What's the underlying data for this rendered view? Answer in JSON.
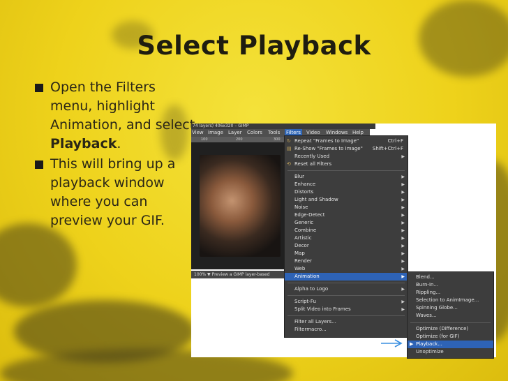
{
  "slide": {
    "title": "Select Playback",
    "bullets": [
      {
        "parts": [
          "Open the Filters menu, highlight Animation, and select ",
          "Playback",
          "."
        ]
      },
      {
        "parts": [
          "This will bring up a playback window where you can preview your GIF.",
          "",
          ""
        ]
      }
    ]
  },
  "gimp": {
    "window_title": "74 layers) 406x320 – GIMP",
    "menubar": [
      "View",
      "Image",
      "Layer",
      "Colors",
      "Tools",
      "Filters",
      "Video",
      "Windows",
      "Help"
    ],
    "active_menu": "Filters",
    "ruler_labels": [
      "100",
      "200",
      "300"
    ],
    "status": "100% ▼ Preview a GIMP layer-based"
  },
  "filters_menu": {
    "top_items": [
      {
        "label": "Repeat \"Frames to Image\"",
        "shortcut": "Ctrl+F",
        "icon": "repeat-icon"
      },
      {
        "label": "Re-Show \"Frames to Image\"",
        "shortcut": "Shift+Ctrl+F",
        "icon": "reshow-icon"
      },
      {
        "label": "Recently Used",
        "submenu": true
      },
      {
        "label": "Reset all Filters",
        "icon": "reset-icon"
      }
    ],
    "categories": [
      "Blur",
      "Enhance",
      "Distorts",
      "Light and Shadow",
      "Noise",
      "Edge-Detect",
      "Generic",
      "Combine",
      "Artistic",
      "Decor",
      "Map",
      "Render",
      "Web",
      "Animation"
    ],
    "highlighted": "Animation",
    "script_items": [
      "Alpha to Logo",
      "Script-Fu",
      "Split Video into Frames"
    ],
    "bottom_items": [
      "Filter all Layers...",
      "Filtermacro..."
    ]
  },
  "animation_menu": {
    "items_top": [
      "Blend...",
      "Burn-In...",
      "Rippling...",
      "Selection to AnimImage...",
      "Spinning Globe...",
      "Waves..."
    ],
    "items_bottom": [
      "Optimize (Difference)",
      "Optimize (for GIF)",
      "Playback...",
      "Unoptimize"
    ],
    "highlighted": "Playback..."
  },
  "colors": {
    "highlight": "#2e63b6",
    "menu_bg": "#3d3d3d",
    "slide_yellow": "#eed21b"
  }
}
